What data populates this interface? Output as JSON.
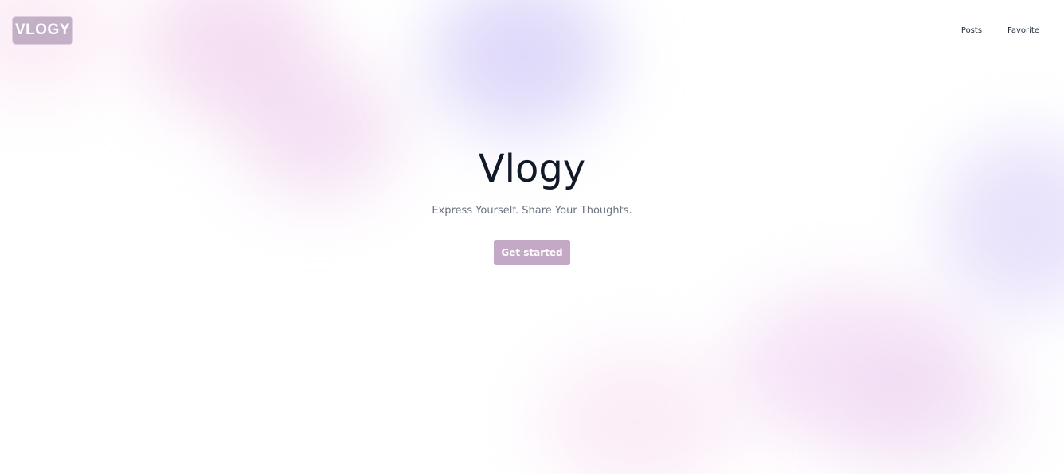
{
  "header": {
    "logo_text": "VLOGY",
    "nav": [
      {
        "label": "Posts"
      },
      {
        "label": "Favorite"
      }
    ]
  },
  "hero": {
    "title": "Vlogy",
    "subtitle": "Express Yourself. Share Your Thoughts.",
    "cta_label": "Get started"
  },
  "colors": {
    "background": "#ffffff",
    "accent": "#c4a9c6",
    "title": "#111827",
    "subtitle": "#6b7280"
  }
}
